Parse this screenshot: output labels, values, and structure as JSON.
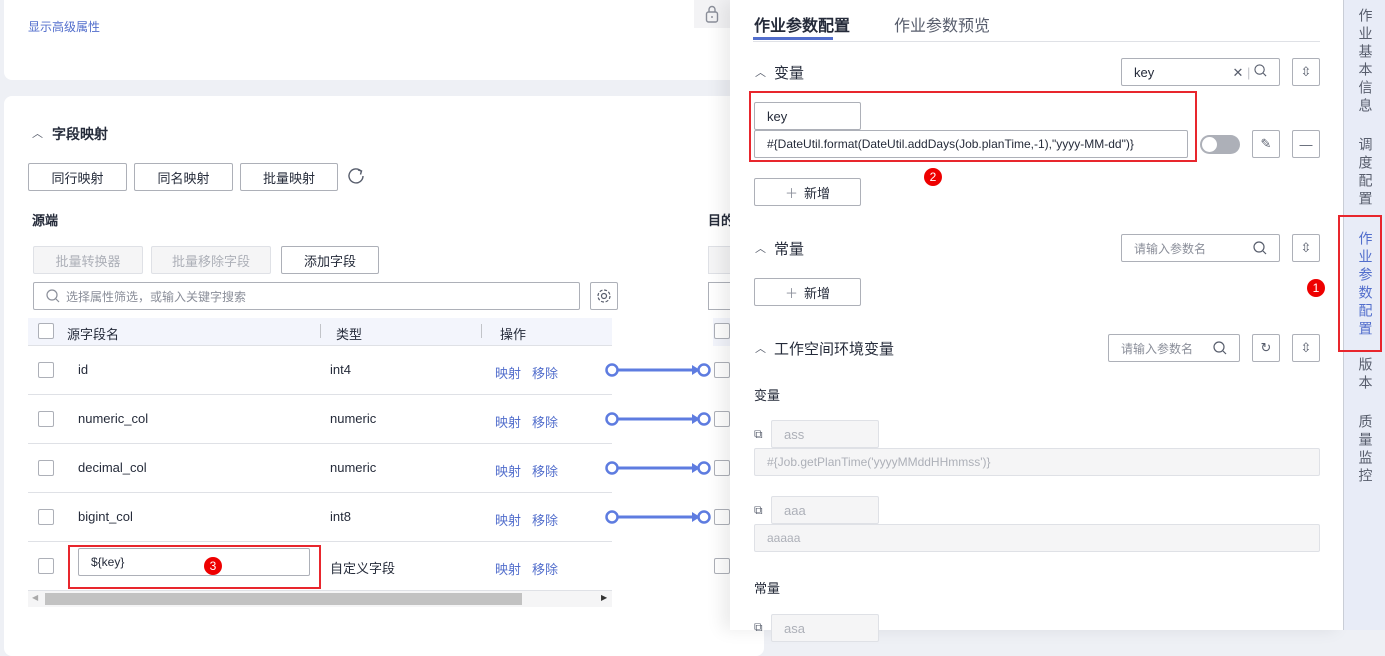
{
  "top_card": {
    "advanced_link": "显示高级属性"
  },
  "mapping": {
    "title": "字段映射",
    "buttons": [
      "同行映射",
      "同名映射",
      "批量映射"
    ],
    "source_label": "源端",
    "target_label": "目的",
    "source_buttons": [
      "批量转换器",
      "批量移除字段",
      "添加字段"
    ],
    "search_placeholder": "选择属性筛选，或输入关键字搜索",
    "columns": [
      "源字段名",
      "类型",
      "操作"
    ],
    "rows": [
      {
        "name": "id",
        "type": "int4",
        "map": "映射",
        "remove": "移除"
      },
      {
        "name": "numeric_col",
        "type": "numeric",
        "map": "映射",
        "remove": "移除"
      },
      {
        "name": "decimal_col",
        "type": "numeric",
        "map": "映射",
        "remove": "移除"
      },
      {
        "name": "bigint_col",
        "type": "int8",
        "map": "映射",
        "remove": "移除"
      },
      {
        "name": "${key}",
        "type": "自定义字段",
        "map": "映射",
        "remove": "移除"
      }
    ]
  },
  "drawer": {
    "tabs": [
      "作业参数配置",
      "作业参数预览"
    ],
    "variables": {
      "title": "变量",
      "search_value": "key",
      "name": "key",
      "value": "#{DateUtil.format(DateUtil.addDays(Job.planTime,-1),\"yyyy-MM-dd\")}",
      "add": "新增"
    },
    "constants": {
      "title": "常量",
      "search_placeholder": "请输入参数名",
      "add": "新增"
    },
    "workspace": {
      "title": "工作空间环境变量",
      "search_placeholder": "请输入参数名",
      "var_label": "变量",
      "const_label": "常量",
      "vars": [
        {
          "name": "ass",
          "value": "#{Job.getPlanTime('yyyyMMddHHmmss')}"
        },
        {
          "name": "aaa",
          "value": "aaaaa"
        }
      ],
      "consts": [
        {
          "name": "asa"
        }
      ]
    }
  },
  "sidebar": {
    "items": [
      "作业基本信息",
      "调度配置",
      "作业参数配置",
      "版本",
      "质量监控"
    ]
  },
  "badges": [
    "1",
    "2",
    "3"
  ],
  "colors": {
    "accent": "#526ecc",
    "highlight": "#e8262d",
    "connector": "#5e7ce0"
  }
}
